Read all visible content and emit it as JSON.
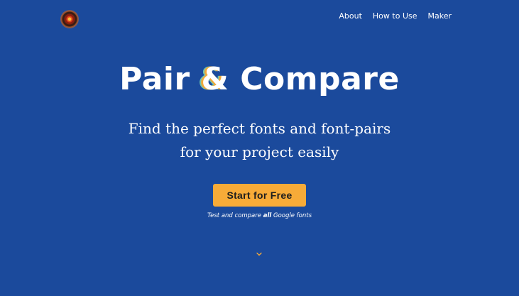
{
  "header": {
    "logo_icon": "concentric-circle-logo-icon",
    "nav": [
      {
        "label": "About"
      },
      {
        "label": "How to Use"
      },
      {
        "label": "Maker"
      }
    ]
  },
  "hero": {
    "title_part1": "Pair ",
    "title_amp": "&",
    "title_part2": " Compare",
    "subtitle_line1": "Find the perfect fonts and font-pairs",
    "subtitle_line2": "for your project easily",
    "cta_label": "Start for Free",
    "note_before": "Test and compare ",
    "note_bold": "all",
    "note_after": " Google fonts",
    "scroll_icon": "chevron-down-icon"
  },
  "colors": {
    "background": "#1b4a9c",
    "accent": "#f7ab38",
    "text": "#ffffff"
  }
}
